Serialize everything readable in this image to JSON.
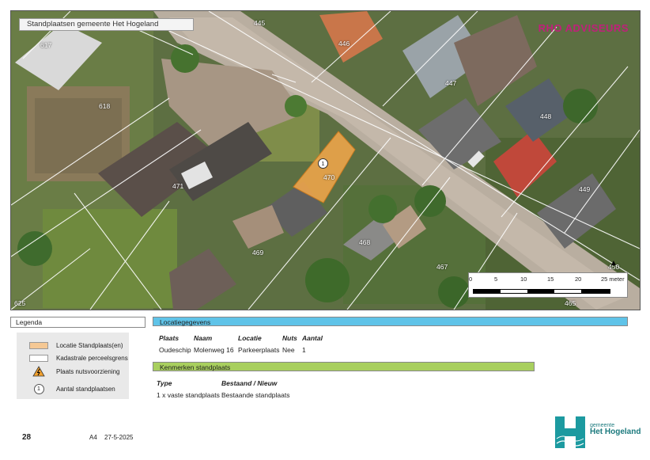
{
  "map": {
    "title": "Standplaatsen gemeente Het Hogeland",
    "brand": "RHO ADVISEURS",
    "plot_labels": [
      "445",
      "446",
      "447",
      "448",
      "449",
      "450",
      "465",
      "467",
      "468",
      "469",
      "470",
      "471",
      "617",
      "618",
      "625"
    ],
    "location_marker": "1",
    "north_label": "▲",
    "scale": {
      "ticks": [
        "0",
        "5",
        "10",
        "15",
        "20",
        "25 meter"
      ]
    }
  },
  "legend": {
    "title": "Legenda",
    "items": [
      {
        "label": "Locatie Standplaats(en)",
        "color": "#f5c894"
      },
      {
        "label": "Kadastrale perceelsgrens",
        "color": "#ffffff"
      },
      {
        "label": "Plaats nutsvoorziening",
        "icon": "warning-icon"
      },
      {
        "label": "Aantal standplaatsen",
        "icon": "number-circle-icon",
        "number": "1"
      }
    ]
  },
  "locatie": {
    "header": "Locatiegegevens",
    "header_color": "#5fc3e8",
    "columns": [
      "Plaats",
      "Naam",
      "Locatie",
      "Nuts",
      "Aantal"
    ],
    "row": [
      "Oudeschip",
      "Molenweg 16",
      "Parkeerplaats",
      "Nee",
      "1"
    ]
  },
  "kenmerken": {
    "header": "Kenmerken standplaats",
    "header_color": "#a8cf5e",
    "columns": [
      "Type",
      "Bestaand / Nieuw"
    ],
    "row": [
      "1 x vaste standplaats",
      "Bestaande standplaats"
    ]
  },
  "footer": {
    "page": "28",
    "format": "A4",
    "date": "27-5-2025",
    "logo_small": "gemeente",
    "logo_big": "Het Hogeland"
  }
}
